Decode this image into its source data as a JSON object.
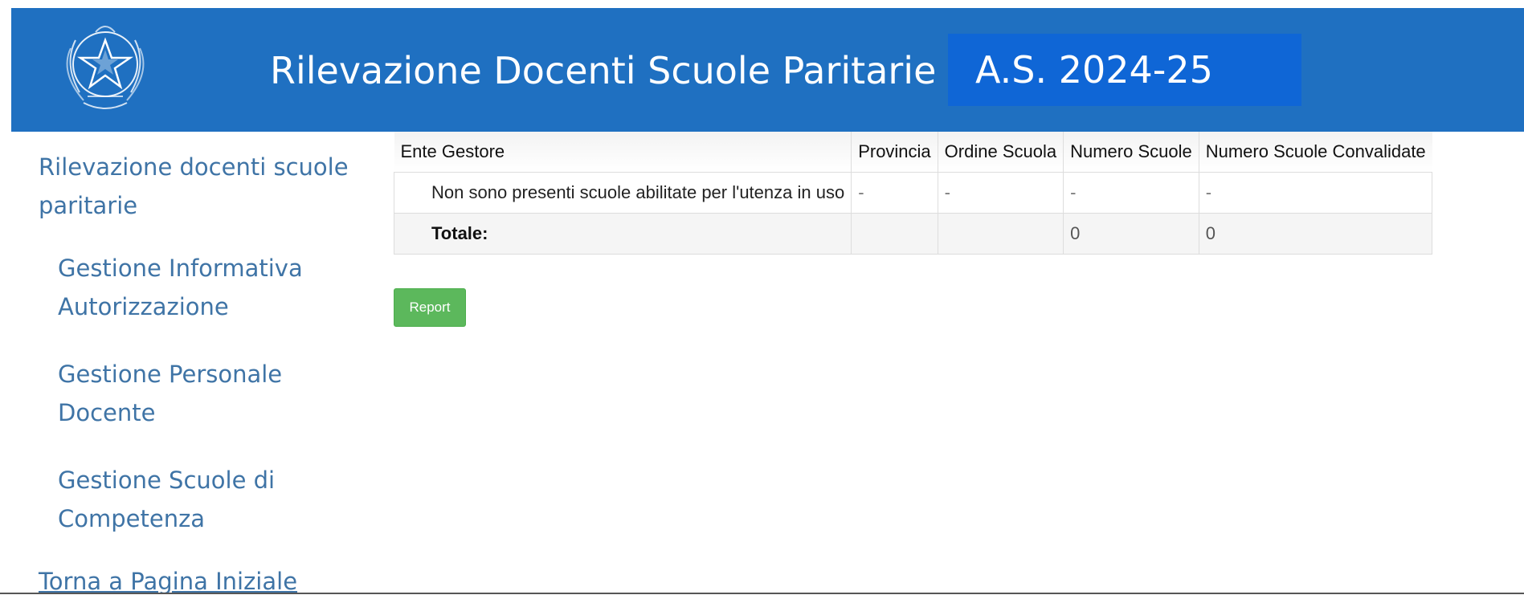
{
  "header": {
    "title": "Rilevazione Docenti Scuole Paritarie -",
    "year_badge": "A.S. 2024-25"
  },
  "sidebar": {
    "main_link": "Rilevazione docenti scuole paritarie",
    "items": [
      {
        "label": "Gestione Informativa Autorizzazione"
      },
      {
        "label": "Gestione Personale Docente"
      },
      {
        "label": "Gestione Scuole di Competenza"
      }
    ],
    "home_link": "Torna a Pagina Iniziale"
  },
  "table": {
    "headers": [
      "Ente Gestore",
      "Provincia",
      "Ordine Scuola",
      "Numero Scuole",
      "Numero Scuole Convalidate"
    ],
    "rows": [
      [
        "Non sono presenti scuole abilitate per l'utenza in uso",
        "-",
        "-",
        "-",
        "-"
      ]
    ],
    "total": [
      "Totale:",
      "",
      "",
      "0",
      "0"
    ]
  },
  "actions": {
    "report_label": "Report"
  },
  "colors": {
    "header_bg": "#1f70c1",
    "badge_bg": "#0f66d6",
    "link": "#3f74a6",
    "report_btn": "#5cb85c"
  },
  "icons": {
    "emblem": "italian-republic-emblem-icon"
  }
}
